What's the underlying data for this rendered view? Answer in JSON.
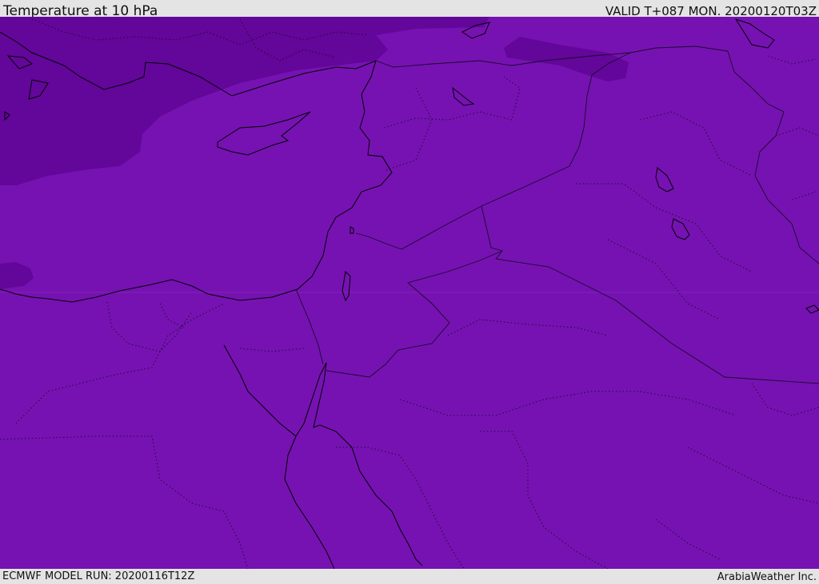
{
  "header": {
    "title": "Temperature at 10 hPa",
    "valid": "VALID T+087 MON. 20200120T03Z"
  },
  "map": {
    "field": "temperature",
    "level": "10 hPa",
    "colors": {
      "base_fill": "#7612b2",
      "cold_fill": "#63069a",
      "coastline": "#000000",
      "border": "#1a0a2a"
    }
  },
  "footer": {
    "model_run": "ECMWF MODEL RUN: 20200116T12Z",
    "credit": "ArabiaWeather Inc."
  }
}
